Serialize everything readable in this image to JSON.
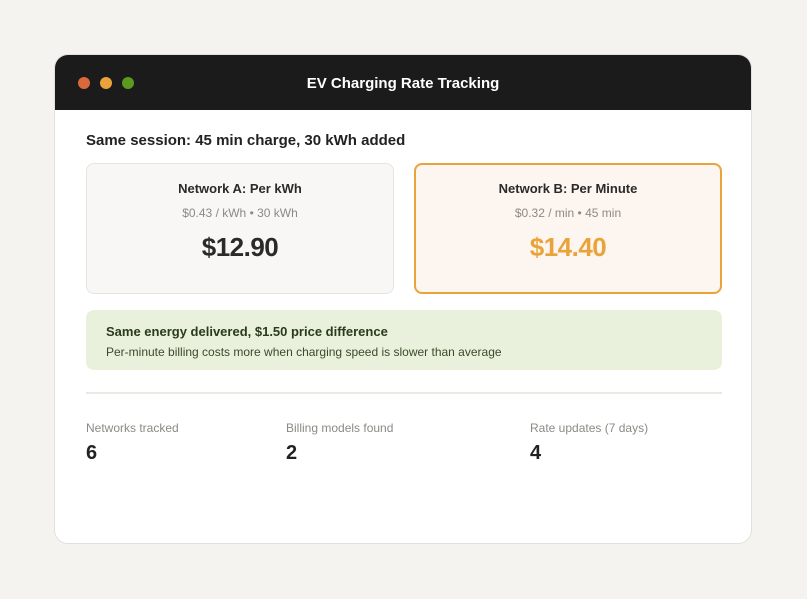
{
  "window": {
    "title": "EV Charging Rate Tracking",
    "controls": [
      {
        "name": "close",
        "color": "#d9683a"
      },
      {
        "name": "minimize",
        "color": "#e9a33a"
      },
      {
        "name": "maximize",
        "color": "#5a9a1e"
      }
    ]
  },
  "session": {
    "heading": "Same session: 45 min charge, 30 kWh added"
  },
  "cards": [
    {
      "title": "Network A: Per kWh",
      "detail": "$0.43 / kWh • 30 kWh",
      "price": "$12.90",
      "price_color": "#2a2a2a"
    },
    {
      "title": "Network B: Per Minute",
      "detail": "$0.32 / min • 45 min",
      "price": "$14.40",
      "price_color": "#e9a33a"
    }
  ],
  "callout": {
    "title": "Same energy delivered, $1.50 price difference",
    "text": "Per-minute billing costs more when charging speed is slower than average"
  },
  "stats": [
    {
      "label": "Networks tracked",
      "value": "6"
    },
    {
      "label": "Billing models found",
      "value": "2"
    },
    {
      "label": "Rate updates (7 days)",
      "value": "4"
    }
  ]
}
